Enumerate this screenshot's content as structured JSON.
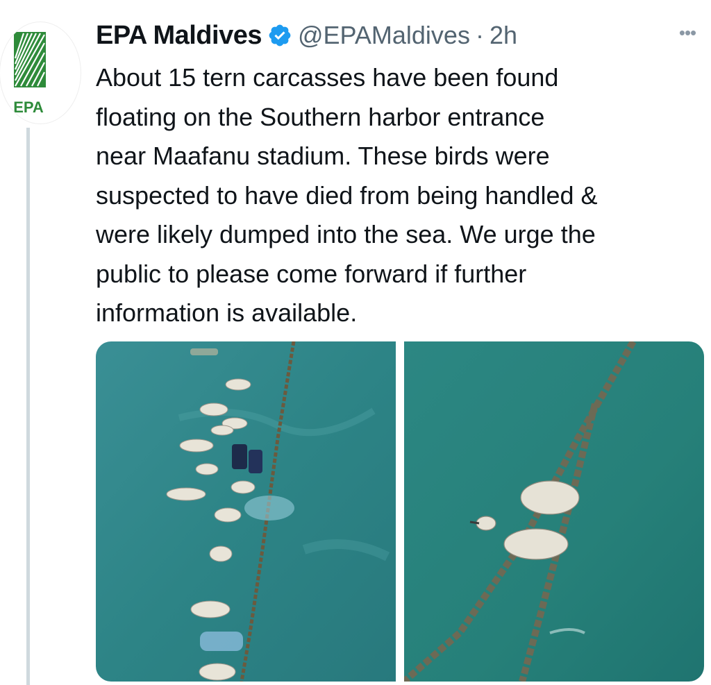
{
  "tweet": {
    "display_name": "EPA Maldives",
    "handle": "@EPAMaldives",
    "separator": "·",
    "timestamp": "2h",
    "avatar_text": "EPA",
    "more_glyph": "•••",
    "text": "About 15 tern carcasses have been found\nfloating on the Southern harbor entrance\nnear Maafanu stadium. These birds were\nsuspected to have died from being handled &\nwere likely dumped into the sea. We urge the\npublic to please come forward if further\ninformation is available."
  },
  "icons": {
    "verified": "verified-badge-icon",
    "more": "more-options-icon",
    "avatar_logo": "palm-leaf-icon"
  },
  "colors": {
    "verified_blue": "#1d9bf0",
    "secondary_text": "#536471",
    "logo_green": "#2e8b3a",
    "water_teal": "#2f8a8a"
  }
}
